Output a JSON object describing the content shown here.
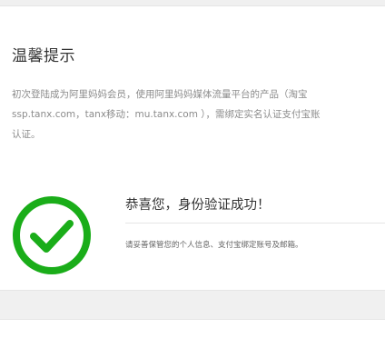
{
  "notice": {
    "title": "温馨提示",
    "description_lines": [
      "初次登陆成为阿里妈妈会员，使用阿里妈妈媒体流量平台的产品（淘宝",
      "ssp.tanx.com，tanx移动：mu.tanx.com ），需绑定实名认证支付宝账",
      "认证。"
    ]
  },
  "verification": {
    "icon": "check-circle-icon",
    "accent_color": "#1aad19",
    "success_title": "恭喜您，身份验证成功！",
    "note": "请妥善保管您的个人信息、支付宝绑定账号及邮箱。"
  }
}
